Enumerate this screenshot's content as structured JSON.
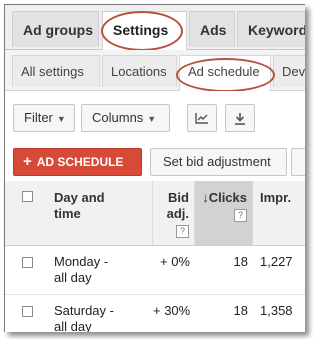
{
  "top_tabs": [
    {
      "label": "Ad groups"
    },
    {
      "label": "Settings",
      "active": true
    },
    {
      "label": "Ads"
    },
    {
      "label": "Keywords"
    }
  ],
  "sub_tabs": [
    {
      "label": "All settings"
    },
    {
      "label": "Locations"
    },
    {
      "label": "Ad schedule",
      "active": true
    },
    {
      "label": "Devices"
    }
  ],
  "toolbar": {
    "filter_label": "Filter",
    "columns_label": "Columns",
    "chart_icon": "line-chart-icon",
    "download_icon": "download-icon"
  },
  "actions": {
    "add_schedule_label": "AD SCHEDULE",
    "set_bid_label": "Set bid adjustment"
  },
  "table": {
    "headers": {
      "day_time": [
        "Day and",
        "time"
      ],
      "bid_adj": [
        "Bid",
        "adj."
      ],
      "clicks": "Clicks",
      "impr": "Impr.",
      "help": "?"
    },
    "rows": [
      {
        "day": [
          "Monday -",
          "all day"
        ],
        "bid_adj": "+ 0%",
        "clicks": "18",
        "impr": "1,227"
      },
      {
        "day": [
          "Saturday -",
          "all day"
        ],
        "bid_adj": "+ 30%",
        "clicks": "18",
        "impr": "1,358"
      }
    ]
  },
  "colors": {
    "accent_red": "#d84a38",
    "highlight_oval": "#b5523d",
    "sorted_column": "#d2d2d2"
  }
}
